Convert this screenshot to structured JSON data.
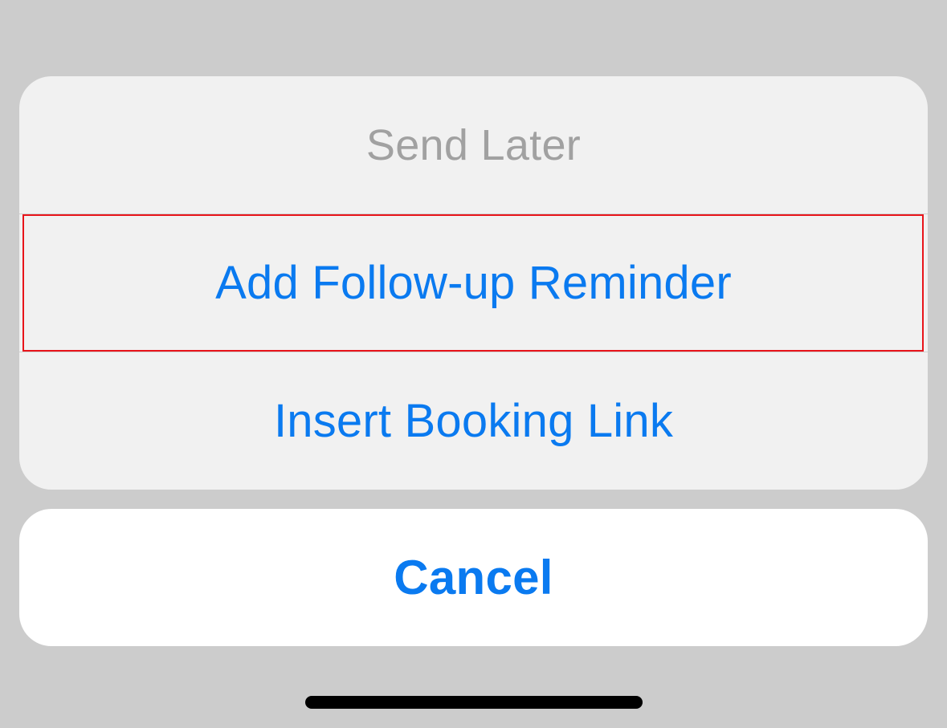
{
  "action_sheet": {
    "title": "Send Later",
    "items": [
      {
        "label": "Add Follow-up Reminder",
        "highlighted": true
      },
      {
        "label": "Insert Booking Link",
        "highlighted": false
      }
    ],
    "cancel_label": "Cancel"
  },
  "colors": {
    "background": "#cccccc",
    "sheet_background": "#f1f1f1",
    "title_text": "#a1a1a1",
    "action_blue": "#0a7af0",
    "highlight_border": "#e8141a",
    "cancel_background": "#ffffff",
    "home_indicator": "#000000"
  }
}
